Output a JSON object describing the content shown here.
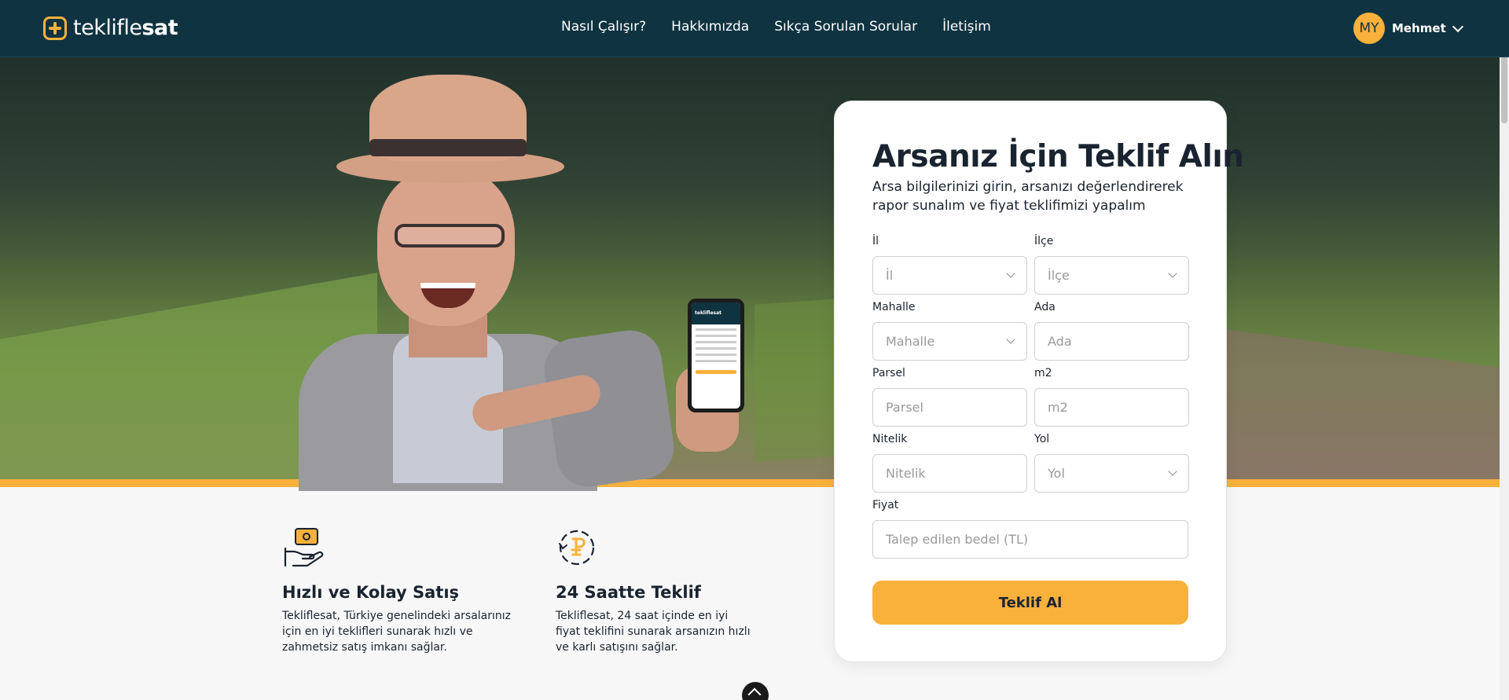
{
  "header": {
    "logo_light": "tekli̇fle",
    "logo_bold": "sat",
    "nav": [
      "Nasıl Çalışır?",
      "Hakkımızda",
      "Sıkça Sorulan Sorular",
      "İletişim"
    ],
    "user_initials": "MY",
    "user_name": "Mehmet"
  },
  "phone_mock": {
    "brand": "tekliflesat"
  },
  "form": {
    "title": "Arsanız İçin Teklif Alın",
    "subtitle": "Arsa bilgilerinizi girin, arsanızı değerlendirerek rapor sunalım ve fiyat teklifimizi yapalım",
    "il_label": "İl",
    "il_placeholder": "İl",
    "ilce_label": "İlçe",
    "ilce_placeholder": "İlçe",
    "mahalle_label": "Mahalle",
    "mahalle_placeholder": "Mahalle",
    "ada_label": "Ada",
    "ada_placeholder": "Ada",
    "parsel_label": "Parsel",
    "parsel_placeholder": "Parsel",
    "m2_label": "m2",
    "m2_placeholder": "m2",
    "nitelik_label": "Nitelik",
    "nitelik_placeholder": "Nitelik",
    "yol_label": "Yol",
    "yol_placeholder": "Yol",
    "fiyat_label": "Fiyat",
    "fiyat_placeholder": "Talep edilen bedel (TL)",
    "submit": "Teklif Al"
  },
  "features": [
    {
      "icon": "hand-money-icon",
      "title": "Hızlı ve Kolay Satış",
      "text": "Tekliflesat, Türkiye genelindeki arsalarınız için en iyi teklifleri sunarak hızlı ve zahmetsiz satış imkanı sağlar."
    },
    {
      "icon": "clock-coin-icon",
      "title": "24 Saatte Teklif",
      "text": "Tekliflesat, 24 saat içinde en iyi fiyat teklifini sunarak arsanızın hızlı ve karlı satışını sağlar."
    }
  ],
  "colors": {
    "header_bg": "#0f3340",
    "accent": "#f9b13c",
    "text": "#1a2330"
  }
}
